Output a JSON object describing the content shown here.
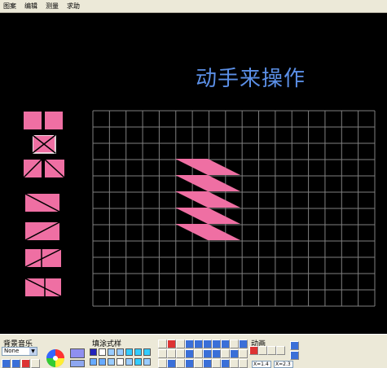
{
  "menu": {
    "items": [
      "图案",
      "编辑",
      "测量",
      "求助"
    ]
  },
  "canvas": {
    "title": "动手来操作"
  },
  "grid": {
    "cols": 17,
    "rows": 12,
    "color": "#808080"
  },
  "shapes": {
    "fill": "#ef6fa3",
    "dark": "#c4487c"
  },
  "toolbar": {
    "music_label": "背景音乐",
    "music_select": "None",
    "fill_label": "填涂式样",
    "animation_label": "动画",
    "status_x": "X=1.4",
    "status_y": "X=2.3"
  }
}
